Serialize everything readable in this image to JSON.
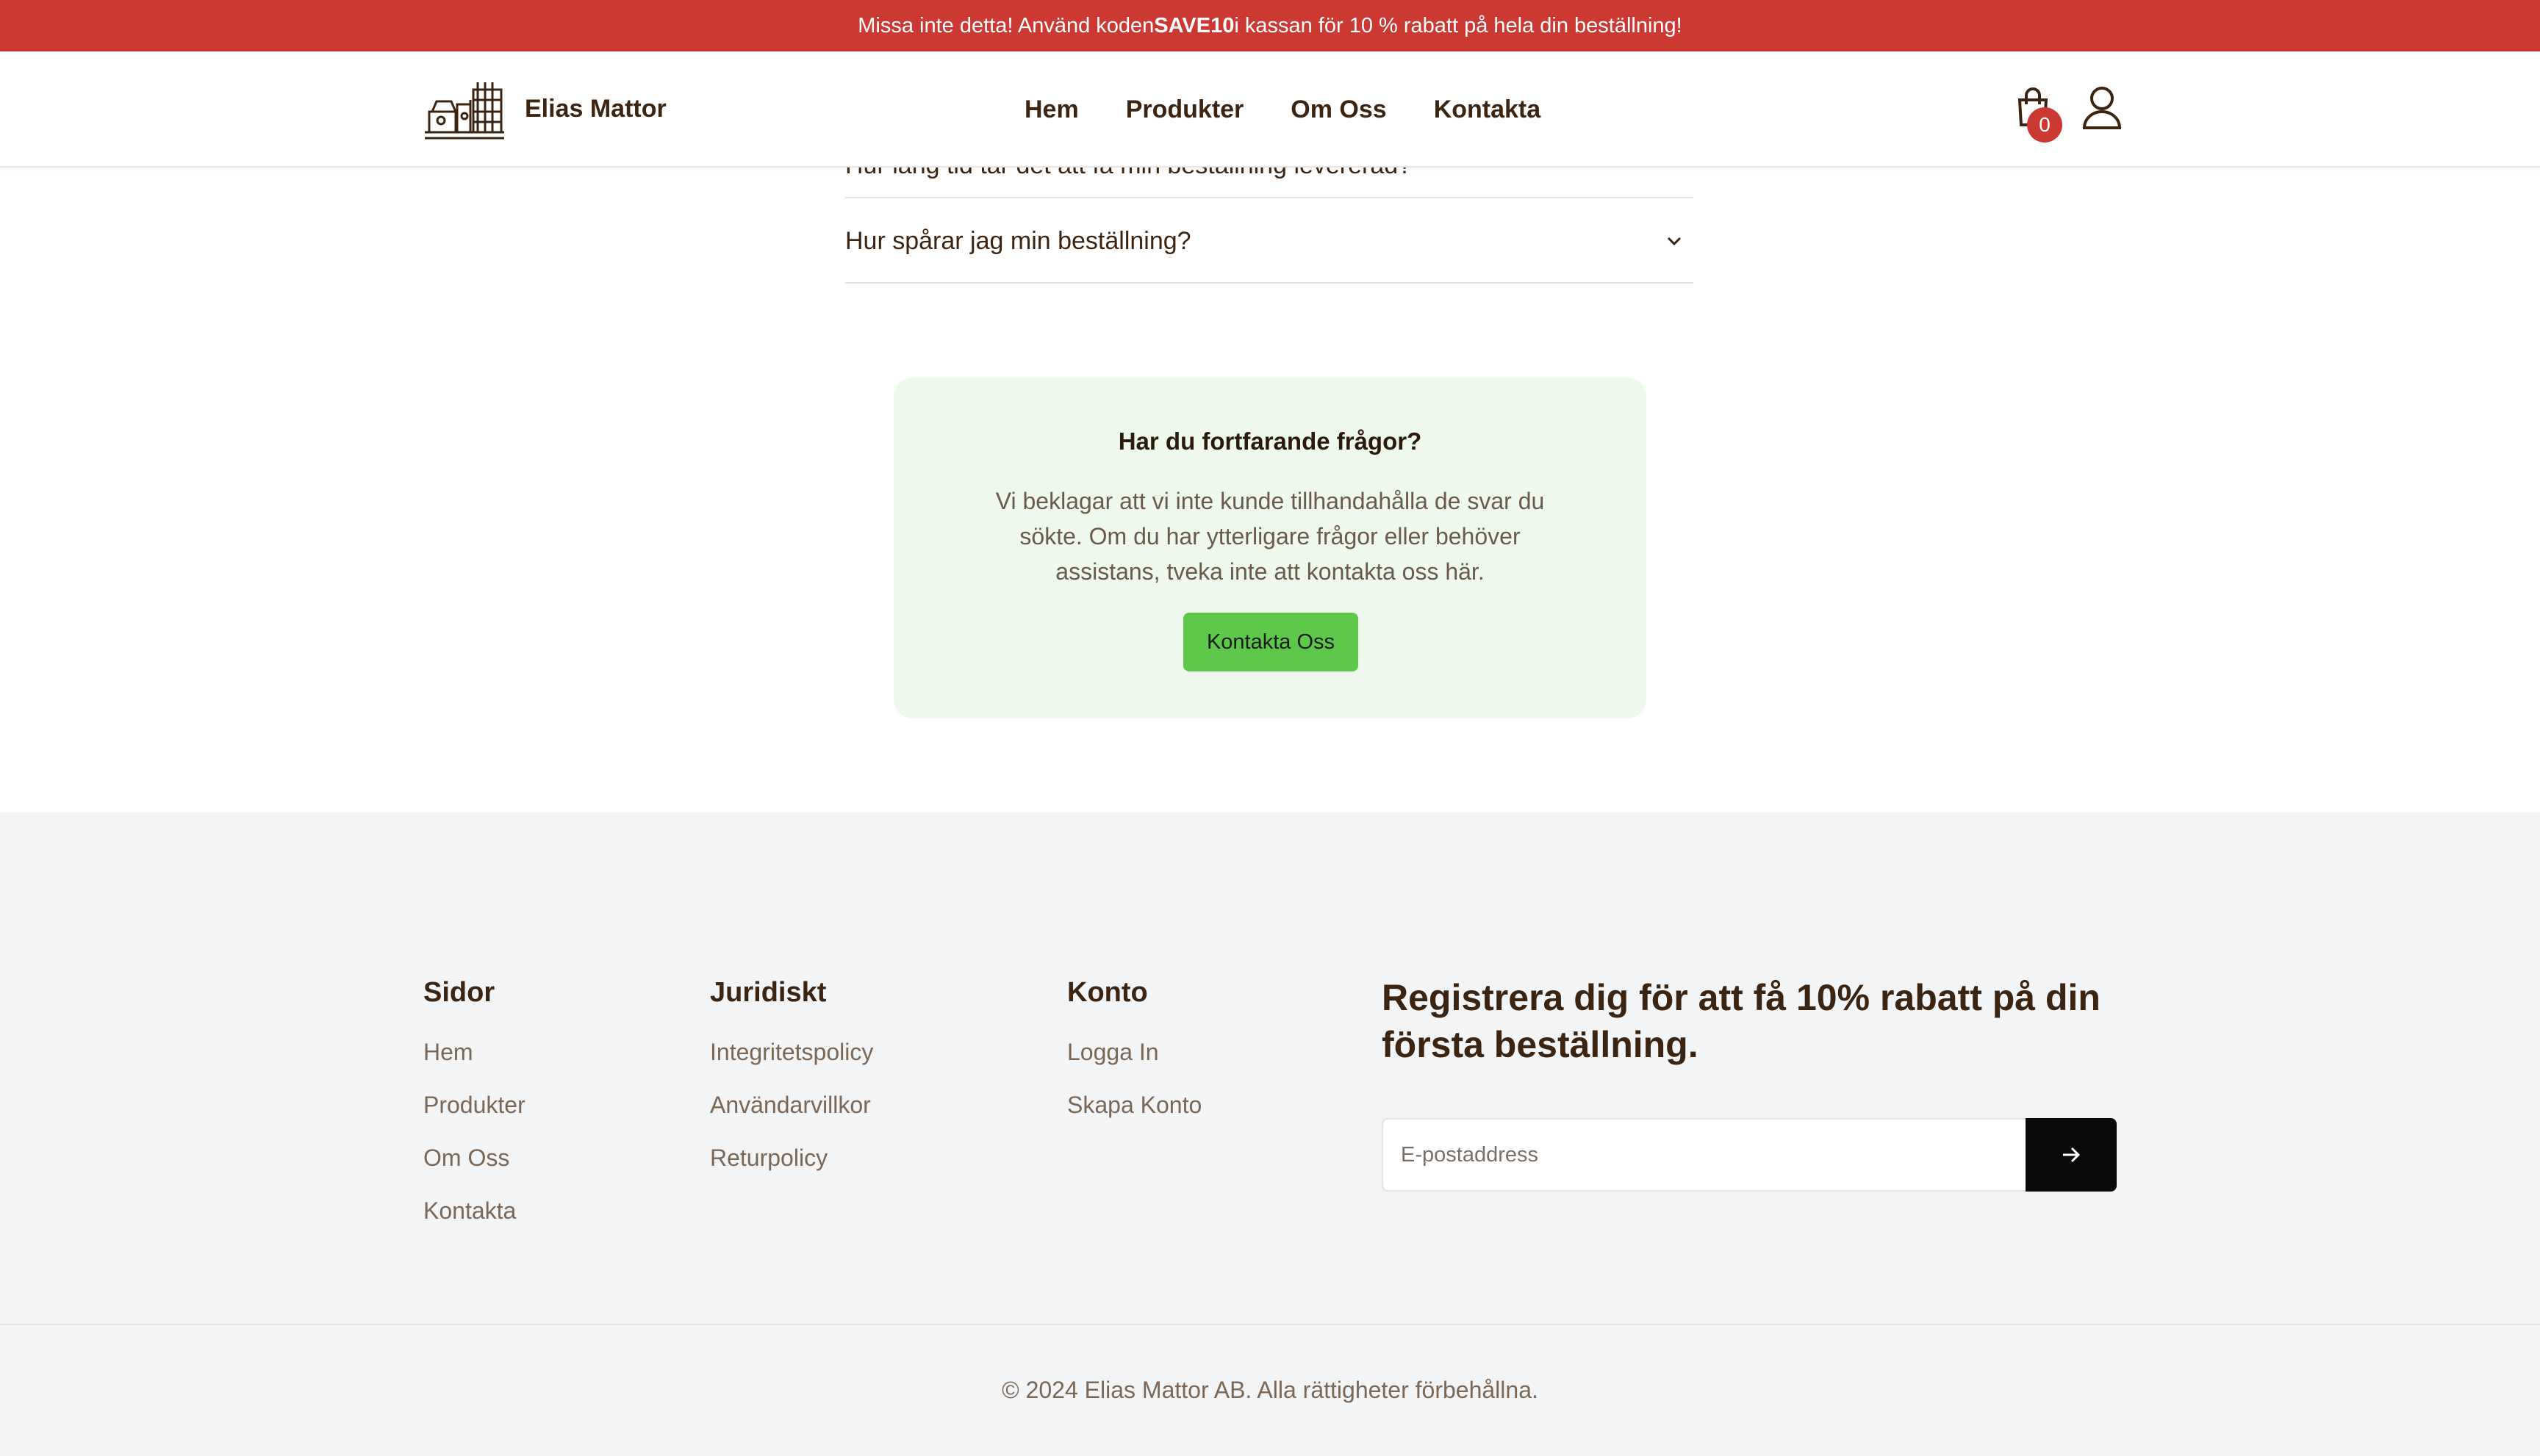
{
  "promo": {
    "before": "Missa inte detta! Använd koden ",
    "code": "SAVE10",
    "after": " i kassan för 10 % rabatt på hela din beställning!"
  },
  "header": {
    "brand": "Elias Mattor",
    "nav": [
      "Hem",
      "Produkter",
      "Om Oss",
      "Kontakta"
    ],
    "cart_count": "0"
  },
  "faq": {
    "partial_question": "Hur lång tid tar det att få min beställning levererad?",
    "question": "Hur spårar jag min beställning?"
  },
  "help": {
    "title": "Har du fortfarande frågor?",
    "text": "Vi beklagar att vi inte kunde tillhandahålla de svar du sökte. Om du har ytterligare frågor eller behöver assistans, tveka inte att kontakta oss här.",
    "button": "Kontakta Oss"
  },
  "footer": {
    "columns": [
      {
        "title": "Sidor",
        "links": [
          "Hem",
          "Produkter",
          "Om Oss",
          "Kontakta"
        ]
      },
      {
        "title": "Juridiskt",
        "links": [
          "Integritetspolicy",
          "Användarvillkor",
          "Returpolicy"
        ]
      },
      {
        "title": "Konto",
        "links": [
          "Logga In",
          "Skapa Konto"
        ]
      }
    ],
    "signup_title": "Registrera dig för att få 10% rabatt på din första beställning.",
    "email_placeholder": "E-postaddress",
    "copyright": "© 2024 Elias Mattor AB. Alla rättigheter förbehållna."
  },
  "colors": {
    "promo_bg": "#cc3932",
    "text_brown": "#3b2412",
    "help_bg": "#eef8ec",
    "button_green": "#5dc84a",
    "footer_bg": "#f3f4f6"
  },
  "icons": [
    "logo-icon",
    "cart-icon",
    "user-icon",
    "chevron-down-icon",
    "arrow-right-icon"
  ]
}
